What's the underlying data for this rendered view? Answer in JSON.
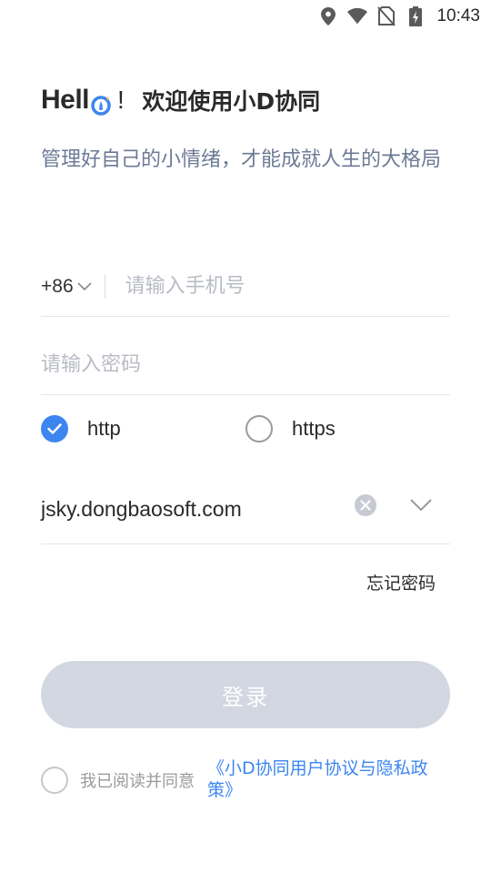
{
  "status_bar": {
    "time": "10:43",
    "icons": [
      "location-icon",
      "wifi-icon",
      "no-sim-icon",
      "battery-charging-icon"
    ]
  },
  "header": {
    "logo_text_hell": "Hell",
    "logo_exclaim": "!",
    "welcome": "欢迎使用小D协同",
    "subtitle": "管理好自己的小情绪，才能成就人生的大格局"
  },
  "form": {
    "country_code": "+86",
    "phone_placeholder": "请输入手机号",
    "password_placeholder": "请输入密码",
    "protocols": [
      {
        "label": "http",
        "selected": true
      },
      {
        "label": "https",
        "selected": false
      }
    ],
    "server": "jsky.dongbaosoft.com",
    "forgot_password": "忘记密码",
    "login_label": "登录"
  },
  "agreement": {
    "prefix": "我已阅读并同意",
    "link": "《小D协同用户协议与隐私政策》",
    "checked": false
  },
  "colors": {
    "accent": "#3d86f0",
    "button_disabled": "#d3d7e2",
    "subtitle": "#6c7a96",
    "placeholder": "#b9bcc4"
  }
}
